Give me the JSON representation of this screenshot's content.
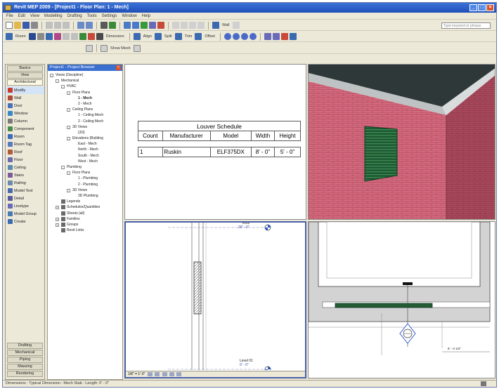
{
  "window": {
    "title": "Revit MEP 2009 - [Project1 - Floor Plan: 1 - Mech]"
  },
  "menu": {
    "items": [
      "File",
      "Edit",
      "View",
      "Modelling",
      "Drafting",
      "Tools",
      "Settings",
      "Window",
      "Help"
    ]
  },
  "toolbar2": {
    "wall_label": "Wall",
    "search_placeholder": "Type keyword or phrase"
  },
  "toolbar3": {
    "room_label": "Room",
    "dimension_label": "Dimension",
    "align_label": "Align",
    "split_label": "Split",
    "trim_label": "Trim",
    "offset_label": "Offset"
  },
  "toolbar4": {
    "view_label": "Show Mesh"
  },
  "design_bar": {
    "tabs": [
      "Basics",
      "View",
      "Architectural"
    ],
    "items": [
      {
        "label": "Modify",
        "icon": "modify-icon",
        "color": "#c83a2b"
      },
      {
        "label": "Wall",
        "icon": "wall-icon",
        "color": "#b04a3a"
      },
      {
        "label": "Door",
        "icon": "door-icon",
        "color": "#4a6fb8"
      },
      {
        "label": "Window",
        "icon": "window-icon",
        "color": "#3a88c8"
      },
      {
        "label": "Column",
        "icon": "column-icon",
        "color": "#7a7a7a"
      },
      {
        "label": "Component",
        "icon": "component-icon",
        "color": "#4a8a4a"
      },
      {
        "label": "Room",
        "icon": "room-icon",
        "color": "#3a6ab8"
      },
      {
        "label": "Room Tag",
        "icon": "room-tag-icon",
        "color": "#5a7ac0"
      },
      {
        "label": "Roof",
        "icon": "roof-icon",
        "color": "#b05a3a"
      },
      {
        "label": "Floor",
        "icon": "floor-icon",
        "color": "#6a6ab0"
      },
      {
        "label": "Ceiling",
        "icon": "ceiling-icon",
        "color": "#5a8ab0"
      },
      {
        "label": "Stairs",
        "icon": "stairs-icon",
        "color": "#7a5a9a"
      },
      {
        "label": "Railing",
        "icon": "railing-icon",
        "color": "#6a8ab0"
      },
      {
        "label": "Model Text",
        "icon": "model-text-icon",
        "color": "#4a6ab0"
      },
      {
        "label": "Detail",
        "icon": "detail-icon",
        "color": "#5a5a9a"
      },
      {
        "label": "Linetype",
        "icon": "linetype-icon",
        "color": "#6a6ab8"
      },
      {
        "label": "Model Group",
        "icon": "model-group-icon",
        "color": "#4a7ab8"
      },
      {
        "label": "Create",
        "icon": "create-icon",
        "color": "#3a6ab0"
      }
    ],
    "bottom_tabs": [
      "Drafting",
      "Mechanical",
      "Piping",
      "Massing",
      "Rendering"
    ]
  },
  "browser": {
    "title": "Project1 - Project Browser",
    "rows": [
      {
        "t": "Views (Discipline)",
        "d": 0,
        "tw": "-"
      },
      {
        "t": "Mechanical",
        "d": 1,
        "tw": "-"
      },
      {
        "t": "HVAC",
        "d": 2,
        "tw": "-"
      },
      {
        "t": "Floor Plans",
        "d": 3,
        "tw": "-"
      },
      {
        "t": "1 - Mech",
        "d": 4,
        "tw": "",
        "bold": true
      },
      {
        "t": "2 - Mech",
        "d": 4,
        "tw": ""
      },
      {
        "t": "Ceiling Plans",
        "d": 3,
        "tw": "-"
      },
      {
        "t": "1 - Ceiling Mech",
        "d": 4,
        "tw": ""
      },
      {
        "t": "2 - Ceiling Mech",
        "d": 4,
        "tw": ""
      },
      {
        "t": "3D Views",
        "d": 3,
        "tw": "-"
      },
      {
        "t": "{3D}",
        "d": 4,
        "tw": ""
      },
      {
        "t": "Elevations (Building",
        "d": 3,
        "tw": "-"
      },
      {
        "t": "East - Mech",
        "d": 4,
        "tw": ""
      },
      {
        "t": "North - Mech",
        "d": 4,
        "tw": ""
      },
      {
        "t": "South - Mech",
        "d": 4,
        "tw": ""
      },
      {
        "t": "West - Mech",
        "d": 4,
        "tw": ""
      },
      {
        "t": "Plumbing",
        "d": 2,
        "tw": "-"
      },
      {
        "t": "Floor Plans",
        "d": 3,
        "tw": "-"
      },
      {
        "t": "1 - Plumbing",
        "d": 4,
        "tw": ""
      },
      {
        "t": "2 - Plumbing",
        "d": 4,
        "tw": ""
      },
      {
        "t": "3D Views",
        "d": 3,
        "tw": "-"
      },
      {
        "t": "3D Plumbing",
        "d": 4,
        "tw": ""
      },
      {
        "t": "Legends",
        "d": 1,
        "tw": "",
        "ico": true
      },
      {
        "t": "Schedules/Quantities",
        "d": 1,
        "tw": "+",
        "ico": true
      },
      {
        "t": "Sheets (all)",
        "d": 1,
        "tw": "",
        "ico": true
      },
      {
        "t": "Families",
        "d": 1,
        "tw": "+",
        "ico": true
      },
      {
        "t": "Groups",
        "d": 1,
        "tw": "+",
        "ico": true
      },
      {
        "t": "Revit Links",
        "d": 1,
        "tw": "",
        "ico": true
      }
    ]
  },
  "schedule": {
    "title": "Louver Schedule",
    "headers": [
      "Count",
      "Manufacturer",
      "Model",
      "Width",
      "Height"
    ],
    "rows": [
      [
        "1",
        "Ruskin",
        "ELF375DX",
        "8' - 0\"",
        "5' - 0\""
      ]
    ]
  },
  "levels": {
    "top": "Roof",
    "top_elev": "20' - 0\"",
    "bottom": "Level 01",
    "bottom_elev": "0' - 0\""
  },
  "plan": {
    "dimension": "8' - 0 1/2\""
  },
  "viewbar": {
    "scale": "1/8\" = 1'-0\""
  },
  "status": {
    "text": "Dimensions : Typical Dimension : Mech Stab : Length: 0' - 0\""
  }
}
